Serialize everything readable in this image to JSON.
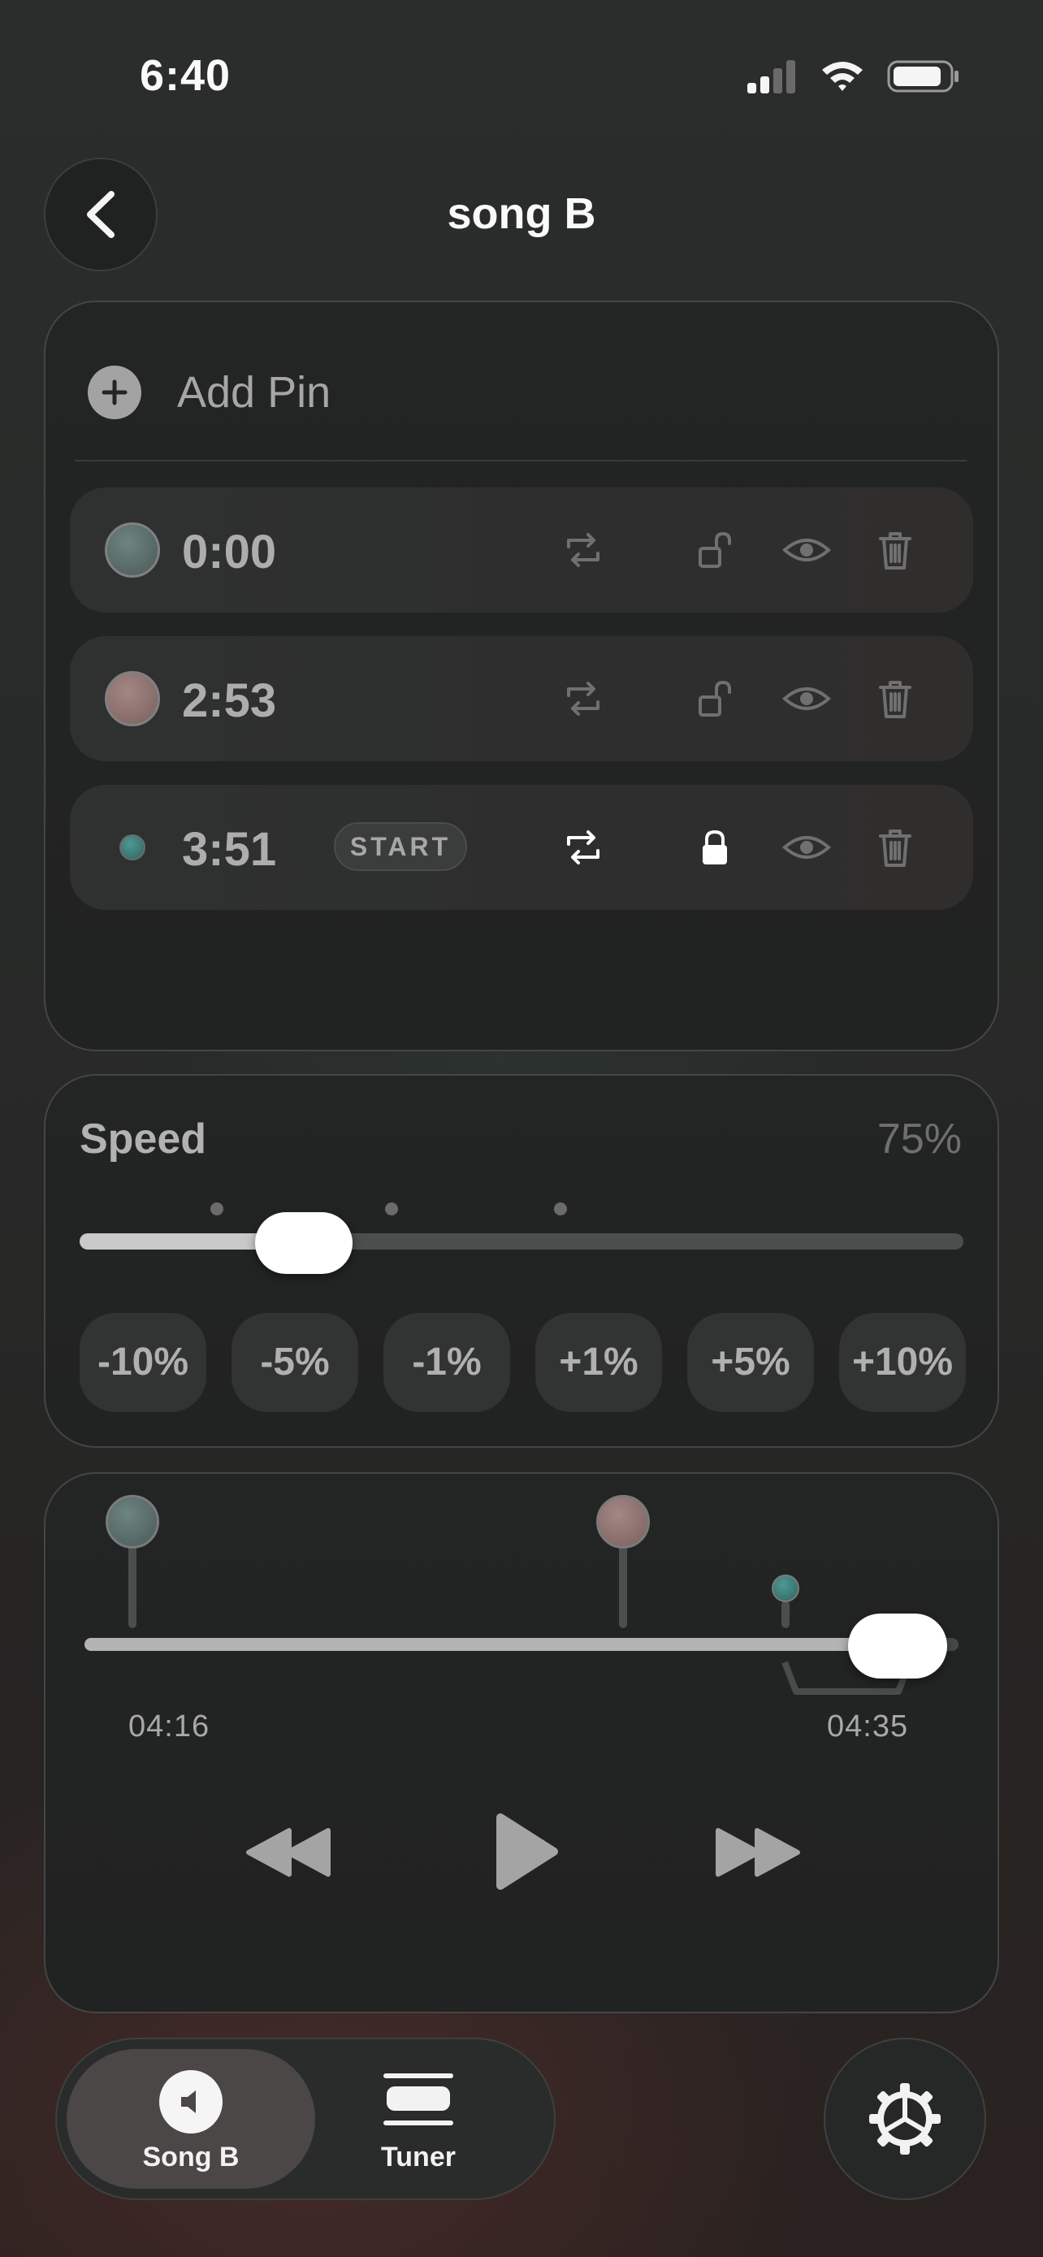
{
  "status_bar": {
    "time": "6:40",
    "icons": [
      "cellular-signal-icon",
      "wifi-icon",
      "battery-icon"
    ]
  },
  "header": {
    "title": "song B",
    "back_icon": "chevron-left-icon"
  },
  "pins": {
    "add_label": "Add Pin",
    "items": [
      {
        "time": "0:00",
        "color": "#5a6d6a",
        "loop_active": false,
        "locked": false,
        "start_badge": ""
      },
      {
        "time": "2:53",
        "color": "#8a6f6c",
        "loop_active": false,
        "locked": false,
        "start_badge": ""
      },
      {
        "time": "3:51",
        "color": "#3f7f7c",
        "loop_active": true,
        "locked": true,
        "start_badge": "START"
      }
    ]
  },
  "speed": {
    "label": "Speed",
    "value_text": "75%",
    "level": 0.75,
    "steps": [
      "-10%",
      "-5%",
      "-1%",
      "+1%",
      "+5%",
      "+10%"
    ]
  },
  "player": {
    "elapsed": "04:16",
    "total": "04:35",
    "progress": 0.93,
    "controls": [
      "rewind-icon",
      "play-icon",
      "fast-forward-icon"
    ]
  },
  "tabs": [
    {
      "label": "Song B",
      "icon": "speaker-icon",
      "active": true
    },
    {
      "label": "Tuner",
      "icon": "tuner-icon",
      "active": false
    }
  ],
  "colors": {
    "accent_teal": "#3f7f7c",
    "pin_rose": "#8a6f6c",
    "pin_slate": "#5a6d6a"
  }
}
